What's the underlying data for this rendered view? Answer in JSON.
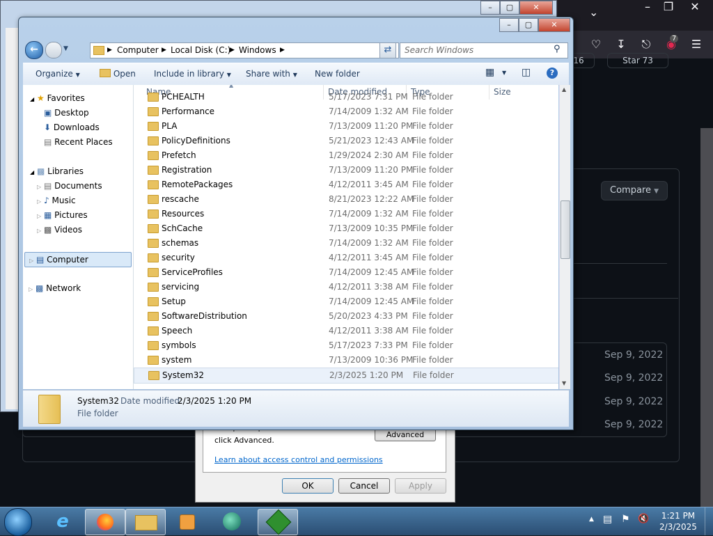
{
  "firefox": {
    "ext_badge": "7",
    "gh_counter": "16",
    "gh_star_label": "Star",
    "gh_star_count": "73",
    "compare_label": "Compare",
    "dates": [
      "Sep 9, 2022",
      "Sep 9, 2022",
      "Sep 9, 2022",
      "Sep 9, 2022"
    ]
  },
  "explorer": {
    "breadcrumbs": [
      "Computer",
      "Local Disk (C:)",
      "Windows"
    ],
    "search_placeholder": "Search Windows",
    "toolbar": {
      "organize": "Organize",
      "open": "Open",
      "include": "Include in library",
      "share": "Share with",
      "new_folder": "New folder"
    },
    "nav": {
      "favorites": "Favorites",
      "desktop": "Desktop",
      "downloads": "Downloads",
      "recent": "Recent Places",
      "libraries": "Libraries",
      "documents": "Documents",
      "music": "Music",
      "pictures": "Pictures",
      "videos": "Videos",
      "computer": "Computer",
      "network": "Network"
    },
    "columns": {
      "name": "Name",
      "date": "Date modified",
      "type": "Type",
      "size": "Size"
    },
    "rows": [
      {
        "name": "PCHEALTH",
        "date": "5/17/2023 7:31 PM",
        "type": "File folder"
      },
      {
        "name": "Performance",
        "date": "7/14/2009 1:32 AM",
        "type": "File folder"
      },
      {
        "name": "PLA",
        "date": "7/13/2009 11:20 PM",
        "type": "File folder"
      },
      {
        "name": "PolicyDefinitions",
        "date": "5/21/2023 12:43 AM",
        "type": "File folder"
      },
      {
        "name": "Prefetch",
        "date": "1/29/2024 2:30 AM",
        "type": "File folder"
      },
      {
        "name": "Registration",
        "date": "7/13/2009 11:20 PM",
        "type": "File folder"
      },
      {
        "name": "RemotePackages",
        "date": "4/12/2011 3:45 AM",
        "type": "File folder"
      },
      {
        "name": "rescache",
        "date": "8/21/2023 12:22 AM",
        "type": "File folder"
      },
      {
        "name": "Resources",
        "date": "7/14/2009 1:32 AM",
        "type": "File folder"
      },
      {
        "name": "SchCache",
        "date": "7/13/2009 10:35 PM",
        "type": "File folder"
      },
      {
        "name": "schemas",
        "date": "7/14/2009 1:32 AM",
        "type": "File folder"
      },
      {
        "name": "security",
        "date": "4/12/2011 3:45 AM",
        "type": "File folder"
      },
      {
        "name": "ServiceProfiles",
        "date": "7/14/2009 12:45 AM",
        "type": "File folder"
      },
      {
        "name": "servicing",
        "date": "4/12/2011 3:38 AM",
        "type": "File folder"
      },
      {
        "name": "Setup",
        "date": "7/14/2009 12:45 AM",
        "type": "File folder"
      },
      {
        "name": "SoftwareDistribution",
        "date": "5/20/2023 4:33 PM",
        "type": "File folder"
      },
      {
        "name": "Speech",
        "date": "4/12/2011 3:38 AM",
        "type": "File folder"
      },
      {
        "name": "symbols",
        "date": "5/17/2023 7:33 PM",
        "type": "File folder"
      },
      {
        "name": "system",
        "date": "7/13/2009 10:36 PM",
        "type": "File folder"
      },
      {
        "name": "System32",
        "date": "2/3/2025 1:20 PM",
        "type": "File folder"
      }
    ],
    "details": {
      "name": "System32",
      "date_label": "Date modified:",
      "date_value": "2/3/2025 1:20 PM",
      "type": "File folder"
    }
  },
  "security_dialog": {
    "partial_text": "For special permissions or advanced settings,",
    "click_advanced": "click Advanced.",
    "advanced": "Advanced",
    "link": "Learn about access control and permissions",
    "ok": "OK",
    "cancel": "Cancel",
    "apply": "Apply"
  },
  "taskbar": {
    "time": "1:21 PM",
    "date": "2/3/2025"
  }
}
